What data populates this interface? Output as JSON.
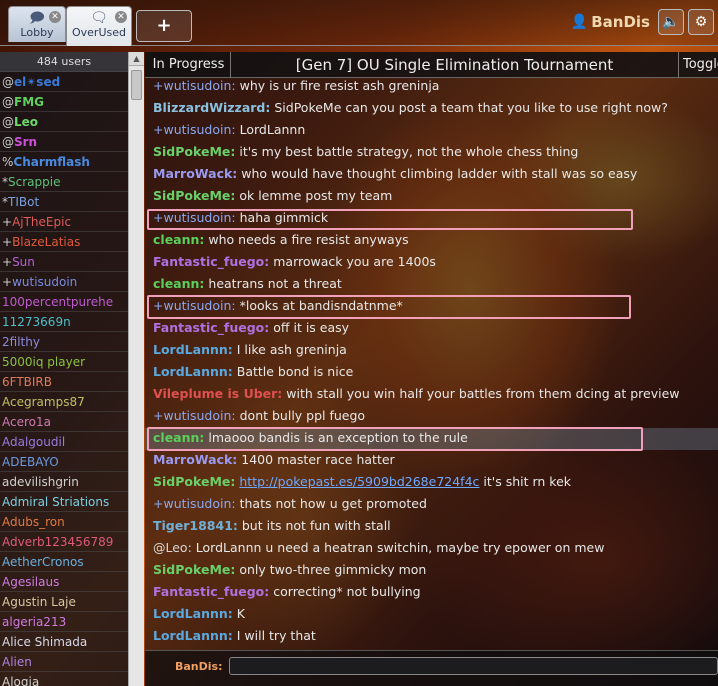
{
  "tabs": {
    "lobby": {
      "label": "Lobby",
      "icon": "chat-bubbles-icon"
    },
    "overused": {
      "label": "OverUsed",
      "icon": "chat-bubble-icon"
    },
    "new_tab": "+"
  },
  "user": {
    "name": "BanDis",
    "icon": "person-icon"
  },
  "toolbar": {
    "sound_icon": "speaker-icon",
    "settings_icon": "gear-icon"
  },
  "userlist": {
    "count": "484 users",
    "users": [
      {
        "rank": "@",
        "name": "el✴sed",
        "color": "#3a7ad8",
        "bold": true
      },
      {
        "rank": "@",
        "name": "FMG",
        "color": "#5fd05f",
        "bold": true
      },
      {
        "rank": "@",
        "name": "Leo",
        "color": "#6cd86c",
        "bold": true
      },
      {
        "rank": "@",
        "name": "Srn",
        "color": "#c94fd8",
        "bold": true
      },
      {
        "rank": "%",
        "name": "Charmflash",
        "color": "#4a8ae0",
        "bold": true
      },
      {
        "rank": "*",
        "name": "Scrappie",
        "color": "#5fc07a",
        "bold": false
      },
      {
        "rank": "*",
        "name": "TIBot",
        "color": "#7aa0e0",
        "bold": false
      },
      {
        "rank": "+",
        "name": "AjTheEpic",
        "color": "#e05a5a",
        "bold": false
      },
      {
        "rank": "+",
        "name": "BlazeLatias",
        "color": "#e05a3a",
        "bold": false
      },
      {
        "rank": "+",
        "name": "Sun",
        "color": "#b860d8",
        "bold": false
      },
      {
        "rank": "+",
        "name": "wutisudoin",
        "color": "#7a8ae0",
        "bold": false
      },
      {
        "rank": "",
        "name": "100percentpurehe",
        "color": "#c05ad0",
        "bold": false
      },
      {
        "rank": "",
        "name": "11273669n",
        "color": "#4ac0c8",
        "bold": false
      },
      {
        "rank": "",
        "name": "2filthy",
        "color": "#8a8ae0",
        "bold": false
      },
      {
        "rank": "",
        "name": "5000iq player",
        "color": "#8ac040",
        "bold": false
      },
      {
        "rank": "",
        "name": "6FTBIRB",
        "color": "#e07a5a",
        "bold": false
      },
      {
        "rank": "",
        "name": "Acegramps87",
        "color": "#c0c060",
        "bold": false
      },
      {
        "rank": "",
        "name": "Acero1a",
        "color": "#d07ab0",
        "bold": false
      },
      {
        "rank": "",
        "name": "Adalgoudil",
        "color": "#9a7ae0",
        "bold": false
      },
      {
        "rank": "",
        "name": "ADEBAYO",
        "color": "#6a9ae0",
        "bold": false
      },
      {
        "rank": "",
        "name": "adevilishgrin",
        "color": "#d0d0d0",
        "bold": false
      },
      {
        "rank": "",
        "name": "Admiral Striations",
        "color": "#7ad0e0",
        "bold": false
      },
      {
        "rank": "",
        "name": "Adubs_ron",
        "color": "#e07a40",
        "bold": false
      },
      {
        "rank": "",
        "name": "Adverb123456789",
        "color": "#e05a7a",
        "bold": false
      },
      {
        "rank": "",
        "name": "AetherCronos",
        "color": "#6ab0e0",
        "bold": false
      },
      {
        "rank": "",
        "name": "Agesilaus",
        "color": "#d07ae0",
        "bold": false
      },
      {
        "rank": "",
        "name": "Agustin Laje",
        "color": "#d8c8a0",
        "bold": false
      },
      {
        "rank": "",
        "name": "algeria213",
        "color": "#d07ae0",
        "bold": false
      },
      {
        "rank": "",
        "name": "Alice Shimada",
        "color": "#d8d8e8",
        "bold": false
      },
      {
        "rank": "",
        "name": "Alien",
        "color": "#b080e0",
        "bold": false
      },
      {
        "rank": "",
        "name": "Alogia",
        "color": "#d0d0d0",
        "bold": false
      }
    ]
  },
  "room": {
    "status": "In Progress",
    "title": "[Gen 7] OU Single Elimination Tournament",
    "toggle": "Toggle"
  },
  "messages": [
    {
      "author": "+wutisudoin:",
      "color": "#8aa8f0",
      "plain": true,
      "text": "why is ur fire resist ash greninja"
    },
    {
      "author": "BlizzardWizzard:",
      "color": "#8ac0e0",
      "plain": false,
      "text": "SidPokeMe can you post a team that you like to use right now?"
    },
    {
      "author": "+wutisudoin:",
      "color": "#8aa8f0",
      "plain": true,
      "text": "LordLannn"
    },
    {
      "author": "SidPokeMe:",
      "color": "#6ad06a",
      "plain": false,
      "text": "it's my best battle strategy, not the whole chess thing"
    },
    {
      "author": "MarroWack:",
      "color": "#9a9af0",
      "plain": false,
      "text": "who would have thought climbing ladder with stall was so easy"
    },
    {
      "author": "SidPokeMe:",
      "color": "#6ad06a",
      "plain": false,
      "text": "ok lemme post my team"
    },
    {
      "author": "+wutisudoin:",
      "color": "#8aa8f0",
      "plain": true,
      "text": "haha gimmick"
    },
    {
      "author": "cleann:",
      "color": "#5ad05a",
      "plain": false,
      "text": "who needs a fire resist anyways"
    },
    {
      "author": "Fantastic_fuego:",
      "color": "#b070e0",
      "plain": false,
      "text": "marrowack you are 1400s"
    },
    {
      "author": "cleann:",
      "color": "#5ad05a",
      "plain": false,
      "text": "heatrans not a threat"
    },
    {
      "author": "+wutisudoin:",
      "color": "#8aa8f0",
      "plain": true,
      "text": "*looks at bandisndatnme*"
    },
    {
      "author": "Fantastic_fuego:",
      "color": "#b070e0",
      "plain": false,
      "text": "off it is easy"
    },
    {
      "author": "LordLannn:",
      "color": "#5aa8e0",
      "plain": false,
      "text": "I like ash greninja"
    },
    {
      "author": "LordLannn:",
      "color": "#5aa8e0",
      "plain": false,
      "text": "Battle bond is nice"
    },
    {
      "author": "Vileplume is Uber:",
      "color": "#e05050",
      "plain": false,
      "text": "with stall you win half your battles from them dcing at preview"
    },
    {
      "author": "+wutisudoin:",
      "color": "#8aa8f0",
      "plain": true,
      "text": "dont bully ppl fuego"
    },
    {
      "author": "cleann:",
      "color": "#5ad05a",
      "plain": false,
      "text": "lmaooo bandis is an exception to the rule"
    },
    {
      "author": "MarroWack:",
      "color": "#9a9af0",
      "plain": false,
      "text": "1400 master race hatter"
    },
    {
      "author": "SidPokeMe:",
      "color": "#6ad06a",
      "plain": false,
      "text": "",
      "link": "http://pokepast.es/5909bd268e724f4c",
      "after": " it's shit rn kek"
    },
    {
      "author": "+wutisudoin:",
      "color": "#8aa8f0",
      "plain": true,
      "text": "thats not how u get promoted"
    },
    {
      "author": "Tiger18841:",
      "color": "#70b0d8",
      "plain": false,
      "text": "but its not fun with stall"
    },
    {
      "author": "@Leo:",
      "color": "#d8d8d8",
      "plain": true,
      "text": "LordLannn u need a heatran switchin, maybe try epower on mew"
    },
    {
      "author": "SidPokeMe:",
      "color": "#6ad06a",
      "plain": false,
      "text": "only two-three gimmicky mon"
    },
    {
      "author": "Fantastic_fuego:",
      "color": "#b070e0",
      "plain": false,
      "text": "correcting* not bullying"
    },
    {
      "author": "LordLannn:",
      "color": "#5aa8e0",
      "plain": false,
      "text": "K"
    },
    {
      "author": "LordLannn:",
      "color": "#5aa8e0",
      "plain": false,
      "text": "I will try that"
    }
  ],
  "composer": {
    "name": "BanDis:",
    "value": ""
  }
}
